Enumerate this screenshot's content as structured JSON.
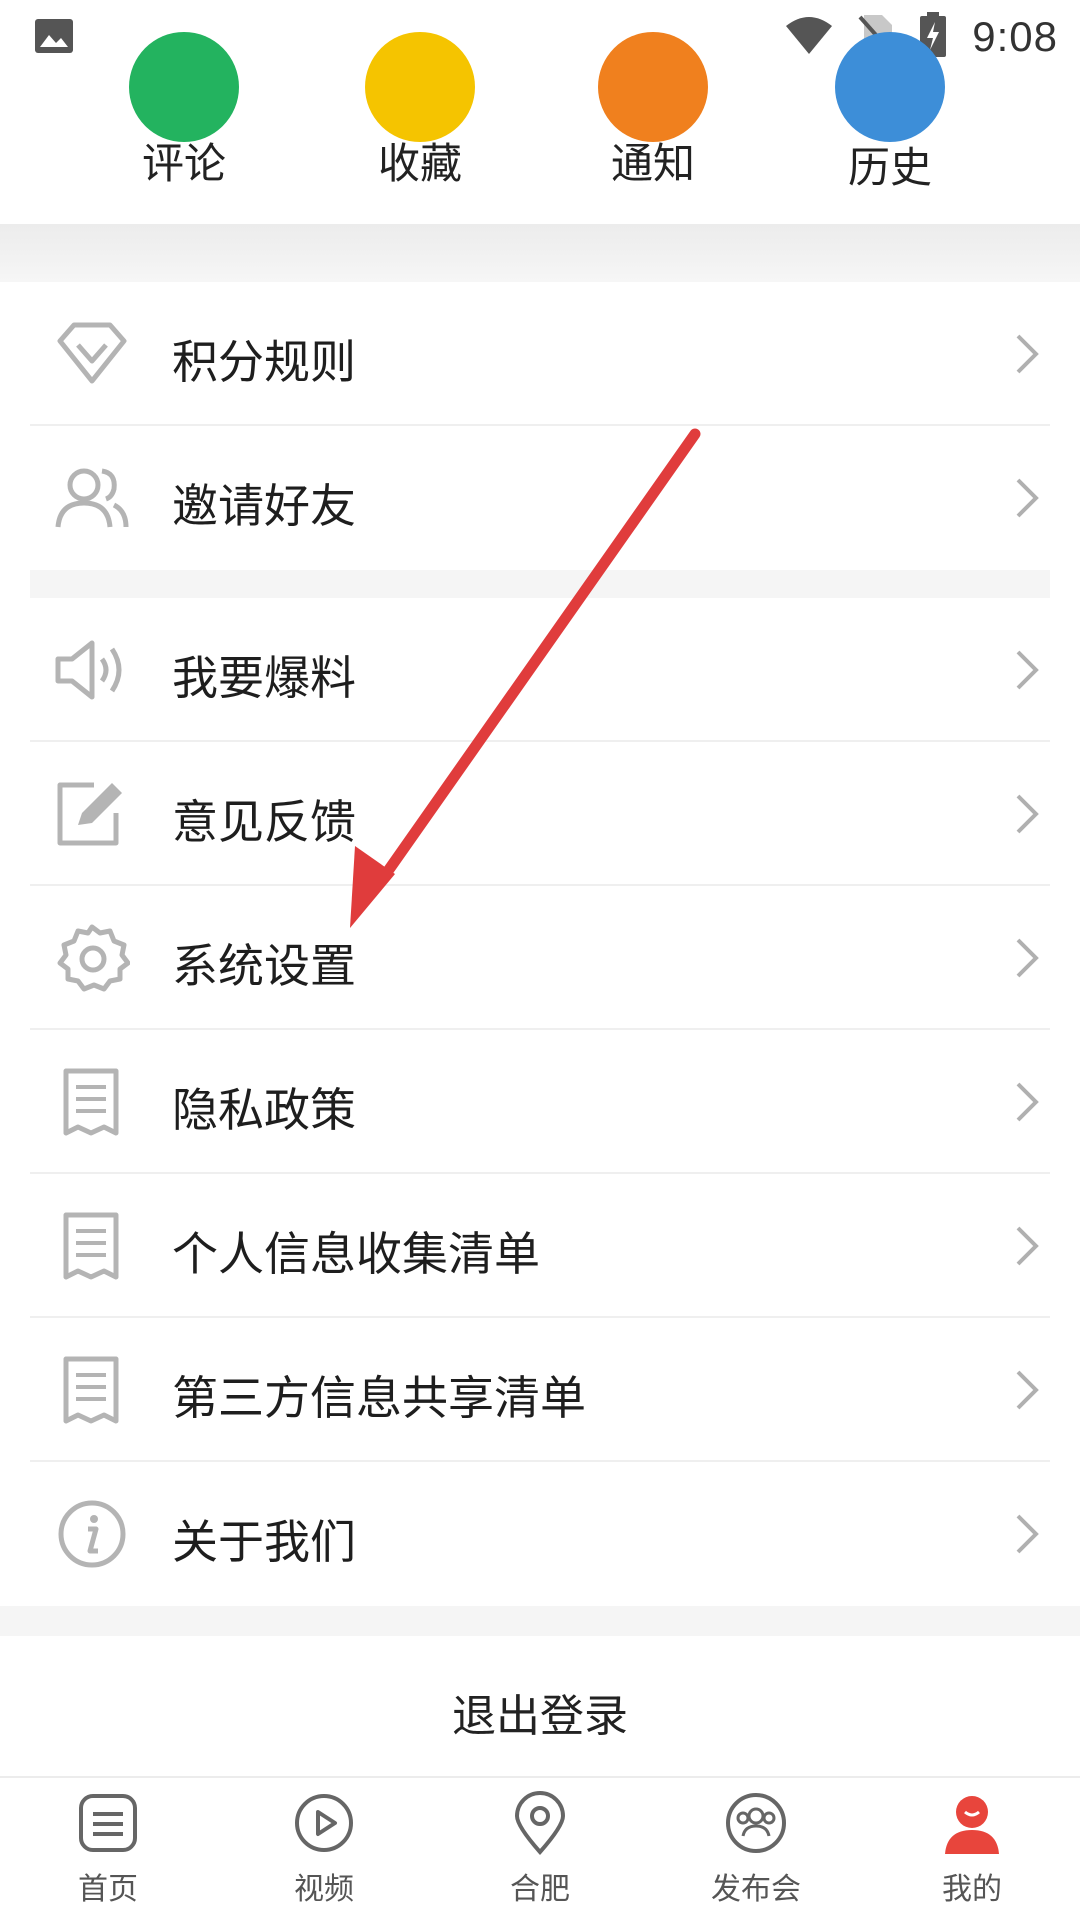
{
  "status_bar": {
    "time": "9:08",
    "icons": [
      "image-icon",
      "wifi-icon",
      "no-sim-icon",
      "battery-charging-icon"
    ]
  },
  "quick_actions": [
    {
      "label": "评论",
      "color": "#23b35f"
    },
    {
      "label": "收藏",
      "color": "#f5c400"
    },
    {
      "label": "通知",
      "color": "#f0801e"
    },
    {
      "label": "历史",
      "color": "#3d8ed8"
    }
  ],
  "menu": {
    "group1": [
      {
        "label": "积分规则",
        "icon": "diamond-icon"
      },
      {
        "label": "邀请好友",
        "icon": "users-icon"
      }
    ],
    "group2": [
      {
        "label": "我要爆料",
        "icon": "speaker-icon"
      },
      {
        "label": "意见反馈",
        "icon": "edit-icon"
      },
      {
        "label": "系统设置",
        "icon": "gear-icon"
      },
      {
        "label": "隐私政策",
        "icon": "document-icon"
      },
      {
        "label": "个人信息收集清单",
        "icon": "document-icon"
      },
      {
        "label": "第三方信息共享清单",
        "icon": "document-icon"
      },
      {
        "label": "关于我们",
        "icon": "info-icon"
      }
    ]
  },
  "logout_label": "退出登录",
  "bottom_nav": [
    {
      "label": "首页",
      "icon": "home-list-icon"
    },
    {
      "label": "视频",
      "icon": "play-icon"
    },
    {
      "label": "合肥",
      "icon": "location-pin-icon"
    },
    {
      "label": "发布会",
      "icon": "group-icon"
    },
    {
      "label": "我的",
      "icon": "profile-avatar-icon",
      "active": true
    }
  ],
  "colors": {
    "icon_gray": "#b4b4b4",
    "annotation_red": "#e03c3c",
    "active_avatar": "#e8453c"
  }
}
